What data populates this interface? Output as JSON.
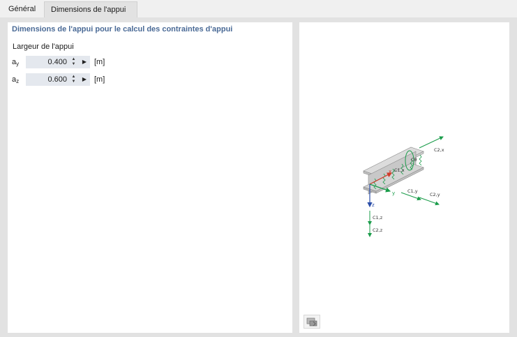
{
  "tabs": [
    {
      "label": "Général"
    },
    {
      "label": "Dimensions de l'appui"
    }
  ],
  "left_panel": {
    "title": "Dimensions de l'appui pour le calcul des contraintes d'appui",
    "group_label": "Largeur de l'appui",
    "rows": [
      {
        "symbol": "a",
        "subscript": "y",
        "value": "0.400",
        "unit": "[m]"
      },
      {
        "symbol": "a",
        "subscript": "z",
        "value": "0.600",
        "unit": "[m]"
      }
    ]
  },
  "diagram": {
    "labels": {
      "x": "x",
      "y": "y",
      "z": "z",
      "c2x": "C2,x",
      "c0": "Cθ",
      "c1x": "C1,x",
      "c1y": "C1,y",
      "c2y": "C2,y",
      "c1z": "C1,z",
      "c2z": "C2,z"
    },
    "colors": {
      "spring": "#1a9c4a",
      "axis_x": "#d23b2a",
      "axis_z": "#2b4ea8",
      "beam": "#c8c8c8"
    }
  },
  "toolbar": {
    "icons": [
      "render-options-icon"
    ]
  }
}
